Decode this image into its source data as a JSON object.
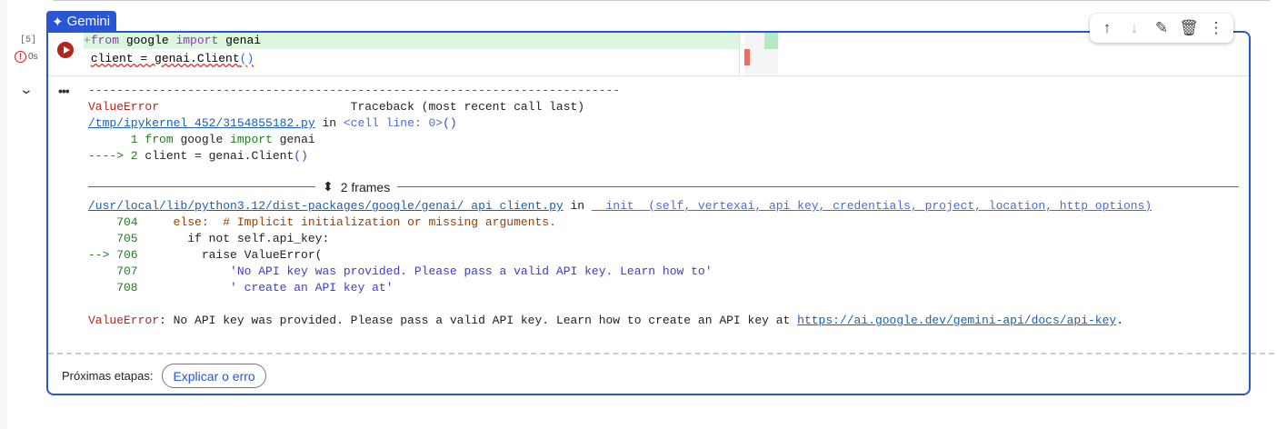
{
  "tab": {
    "label": "Gemini",
    "icon": "sparkle-icon"
  },
  "cell": {
    "exec_count": "[5]",
    "duration": "0s",
    "code": {
      "diff_marker": "+",
      "line1_kw1": "from",
      "line1_mod": " google ",
      "line1_kw2": "import",
      "line1_name": " genai",
      "line2": "client = genai.Client",
      "line2_par": "()"
    }
  },
  "toolbar": {
    "icons": [
      "arrow-up-icon",
      "arrow-down-icon",
      "magic-pen-icon",
      "trash-icon",
      "more-vert-icon"
    ]
  },
  "output": {
    "dashes": "---------------------------------------------------------------------------",
    "err_name": "ValueError",
    "traceback_label": "Traceback (most recent call last)",
    "file1": "/tmp/ipykernel_452/3154855182.py",
    "in": " in ",
    "cell_line": "<cell line: 0>",
    "cell_par": "()",
    "l1_num": "      1 ",
    "l1_kw": "from",
    "l1_mod": " google ",
    "l1_kw2": "import",
    "l1_name": " genai",
    "l2_arrow": "----> 2 ",
    "l2_code": "client = genai.Client",
    "l2_par": "()",
    "frames": "2 frames",
    "file2": "/usr/local/lib/python3.12/dist-packages/google/genai/_api_client.py",
    "func": "__init__(self, vertexai, api_key, credentials, project, location, http_options)",
    "lines": [
      {
        "num": "    704 ",
        "code": "    else:  # Implicit initialization or missing arguments."
      },
      {
        "num": "    705 ",
        "code": "      if not self.api_key:"
      },
      {
        "num": "--> 706 ",
        "code": "        raise ValueError("
      },
      {
        "num": "    707 ",
        "code": "            'No API key was provided. Please pass a valid API key. Learn how to'"
      },
      {
        "num": "    708 ",
        "code": "            ' create an API key at'"
      }
    ],
    "final_name": "ValueError",
    "final_msg": ": No API key was provided. Please pass a valid API key. Learn how to create an API key at ",
    "final_link": "https://ai.google.dev/gemini-api/docs/api-key",
    "final_end": "."
  },
  "next_steps": {
    "label": "Próximas etapas:",
    "button": "Explicar o erro"
  }
}
